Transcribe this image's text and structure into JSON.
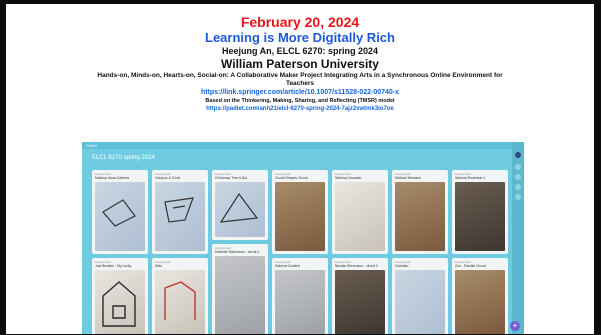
{
  "slide": {
    "date": "February 20, 2024",
    "subtitle": "Learning is More Digitally Rich",
    "author_course": "Heejung An, ELCL 6270: spring 2024",
    "university": "William Paterson University",
    "paper_title": "Hands-on, Minds-on, Hearts-on, Social-on: A Collaborative Maker Project Integrating Arts in a Synchronous Online Environment for Teachers",
    "paper_link": "https://link.springer.com/article/10.1007/s11528-022-00740-x",
    "model_note": "Based on the Thinkering, Making, Sharing, and Reflecting (TMSR) model",
    "padlet_link": "https://padlet.com/anh21/elcl-6270-spring-2024-7ajz2xwtmk3io7oe"
  },
  "padlet": {
    "topbar": "Padlet",
    "board_title": "ELCL 6270 spring 2024",
    "add_glyph": "+",
    "author_label": "Anonymous",
    "cards": [
      {
        "title": "Makeup Alora Cabrera"
      },
      {
        "title": "Octopus & Circle"
      },
      {
        "title": "Christmas Tree & Bot"
      },
      {
        "title": "Circuit Shapes Circuit"
      },
      {
        "title": "Sabrina Crusader"
      },
      {
        "title": "Michael Bresanin"
      },
      {
        "title": "Sabrina Rozenbar 1"
      },
      {
        "title": "Just Breathe - My Lucky"
      },
      {
        "title": "Nelo"
      },
      {
        "title": "Michelle Steinmann - circuit 2"
      },
      {
        "title": "Sabrina Created"
      },
      {
        "title": "Nicolas Stevenson - circuit 2"
      },
      {
        "title": "Christian"
      },
      {
        "title": "Zoe - Parallel Circuit"
      },
      {
        "title": "Dylan"
      },
      {
        "title": "Circuit"
      }
    ]
  }
}
